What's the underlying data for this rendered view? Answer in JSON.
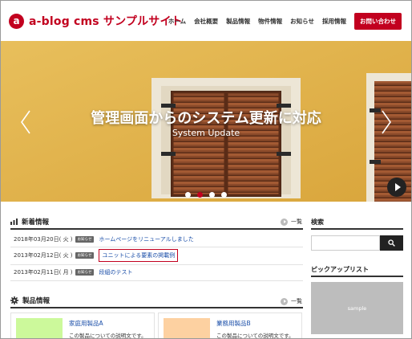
{
  "header": {
    "logo_mark": "a",
    "site_title": "a-blog cms サンプルサイト",
    "nav": [
      "ホーム",
      "会社概要",
      "製品情報",
      "物件情報",
      "お知らせ",
      "採用情報"
    ],
    "contact_label": "お問い合わせ"
  },
  "hero": {
    "title": "管理画面からのシステム更新に対応",
    "subtitle": "System Update",
    "slide_count": 4,
    "active_slide": 2
  },
  "news": {
    "title": "新着情報",
    "more_label": "一覧",
    "items": [
      {
        "date": "2018年03月20日( 火 )",
        "badge": "お知らせ",
        "title": "ホームページをリニューアルしました"
      },
      {
        "date": "2013年02月12日( 火 )",
        "badge": "お知らせ",
        "title": "ユニットによる要素の掲載例"
      },
      {
        "date": "2013年02月11日( 月 )",
        "badge": "お知らせ",
        "title": "段組のテスト"
      }
    ]
  },
  "products": {
    "title": "製品情報",
    "more_label": "一覧",
    "items": [
      {
        "name": "家庭用製品A",
        "desc": "この製品についての説明文です。",
        "thumb_color": "#ccf99b"
      },
      {
        "name": "業務用製品B",
        "desc": "この製品についての説明文です。",
        "thumb_color": "#fdd1a1"
      }
    ]
  },
  "sidebar": {
    "search_title": "検索",
    "search_value": "",
    "pickup_title": "ピックアップリスト",
    "sample_label": "sample"
  },
  "colors": {
    "brand": "#c2001f",
    "link": "#1a4ea8"
  }
}
